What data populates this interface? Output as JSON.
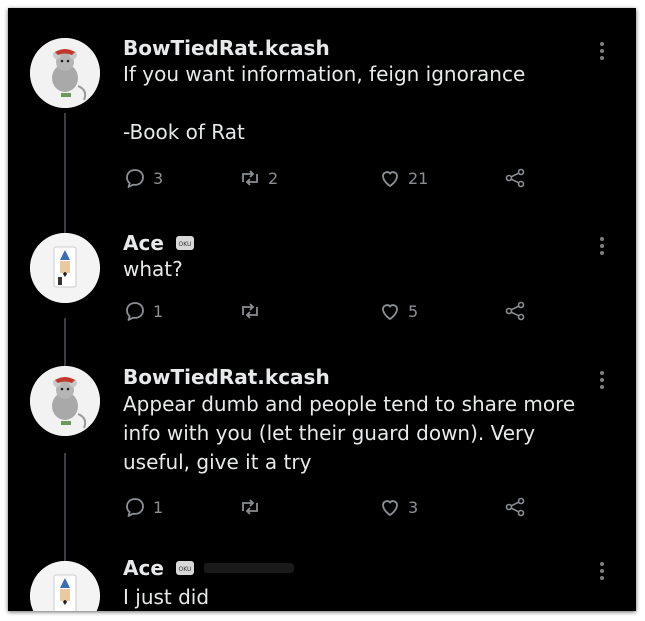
{
  "colors": {
    "background": "#000000",
    "text": "#e7e9ea",
    "muted": "#8b8f93",
    "thread": "#3a3f44"
  },
  "tweets": [
    {
      "name": "BowTiedRat.kcash",
      "lines": "If you want information, feign ignorance\n\n-Book of Rat",
      "avatar": "rat-avatar",
      "replies": "3",
      "retweets": "2",
      "likes": "21"
    },
    {
      "name": "Ace",
      "lines": "what?",
      "avatar": "card-avatar",
      "replies": "1",
      "retweets": "",
      "likes": "5"
    },
    {
      "name": "BowTiedRat.kcash",
      "lines": "Appear dumb and people tend to share more\ninfo with you (let their guard down). Very\nuseful, give it a try",
      "avatar": "rat-avatar",
      "replies": "1",
      "retweets": "",
      "likes": "3"
    },
    {
      "name": "Ace",
      "lines": "I just did",
      "avatar": "card-avatar"
    }
  ]
}
